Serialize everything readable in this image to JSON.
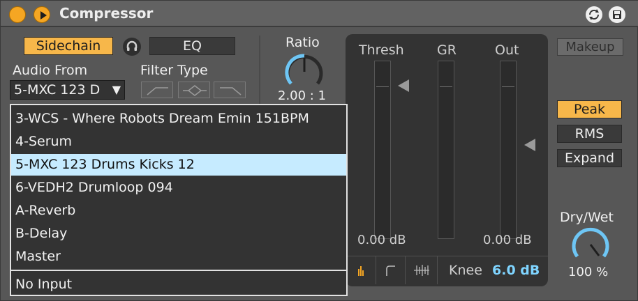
{
  "header": {
    "title": "Compressor",
    "power_icon": "power-icon",
    "play_icon": "play-icon",
    "refresh_icon": "refresh-icon",
    "save_icon": "save-icon"
  },
  "sidechain": {
    "label": "Sidechain",
    "eq_label": "EQ",
    "audio_from_label": "Audio From",
    "audio_from_value": "5-MXC 123 D",
    "filter_type_label": "Filter Type"
  },
  "ratio": {
    "label": "Ratio",
    "value": "2.00 : 1"
  },
  "meters": {
    "thresh_label": "Thresh",
    "gr_label": "GR",
    "out_label": "Out",
    "thresh_db": "0.00 dB",
    "out_db": "0.00 dB",
    "knee_label": "Knee",
    "knee_value": "6.0 dB"
  },
  "controls": {
    "makeup_label": "Makeup",
    "peak_label": "Peak",
    "rms_label": "RMS",
    "expand_label": "Expand",
    "drywet_label": "Dry/Wet",
    "drywet_value": "100 %"
  },
  "dropdown": {
    "items": [
      "3-WCS - Where Robots Dream Emin 151BPM",
      "4-Serum",
      "5-MXC 123 Drums Kicks 12",
      "6-VEDH2 Drumloop 094",
      "A-Reverb",
      "B-Delay",
      "Master"
    ],
    "no_input": "No Input",
    "selected_index": 2
  },
  "colors": {
    "accent": "#f7b74a",
    "selection": "#c6ebff",
    "value_blue": "#7fd4ff"
  }
}
